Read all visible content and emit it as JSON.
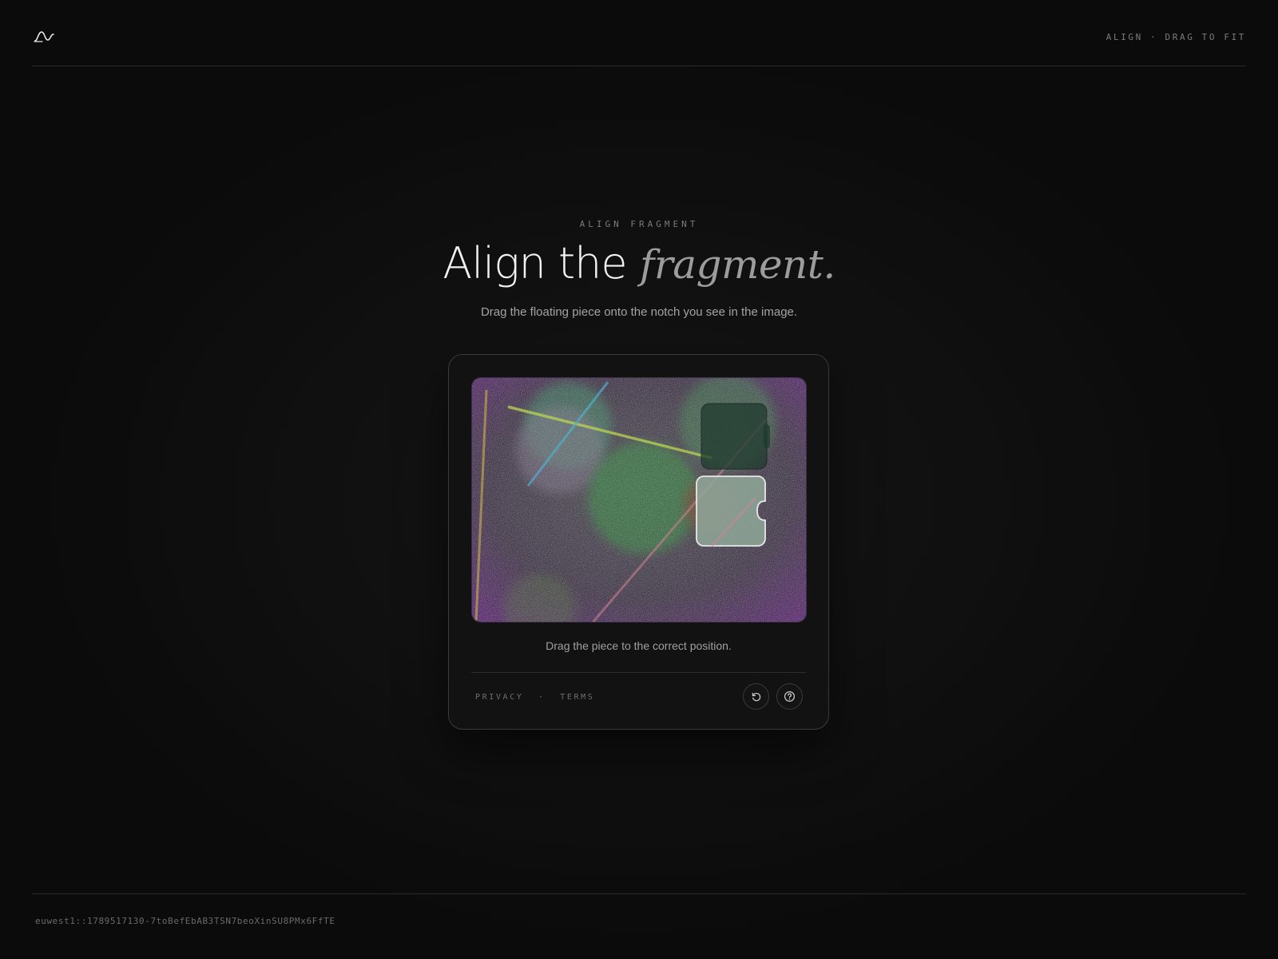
{
  "header": {
    "logo_icon": "wave-logo-icon",
    "status": "ALIGN · DRAG TO FIT"
  },
  "hero": {
    "eyebrow": "ALIGN FRAGMENT",
    "title_plain": "Align the",
    "title_accent": "fragment.",
    "subtitle": "Drag the floating piece onto the notch you see in the image."
  },
  "challenge": {
    "status_text": "Drag the piece to the correct position.",
    "privacy_label": "PRIVACY",
    "separator": "·",
    "terms_label": "TERMS",
    "refresh_icon": "refresh-icon",
    "help_icon": "help-circle-icon",
    "colors": {
      "accent_purple": "#6a2a8c",
      "blob_green": "#2e8a3a",
      "piece_fill": "#8fa89a"
    }
  },
  "footer": {
    "session_id": "euwest1::1789517130-7toBefEbAB3TSN7beoXinSU8PMx6FfTE"
  }
}
